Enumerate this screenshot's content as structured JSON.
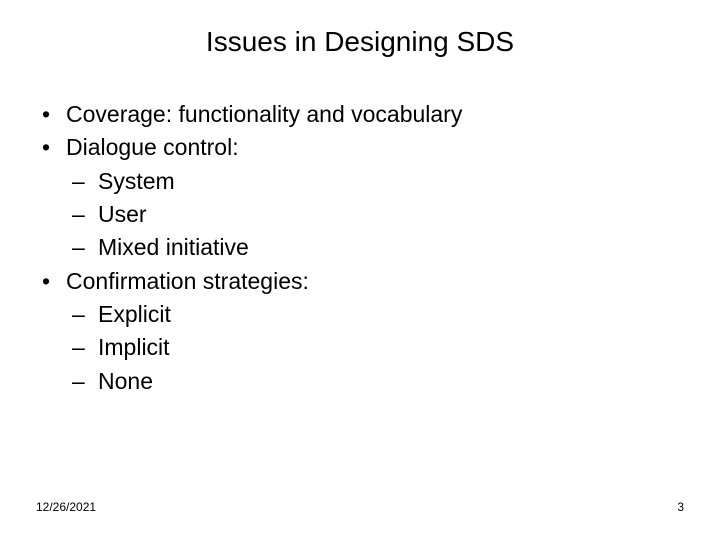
{
  "slide": {
    "title": "Issues in Designing SDS",
    "bullets": [
      {
        "text": "Coverage:  functionality and vocabulary",
        "subs": []
      },
      {
        "text": "Dialogue control:",
        "subs": [
          "System",
          "User",
          "Mixed initiative"
        ]
      },
      {
        "text": "Confirmation strategies:",
        "subs": [
          "Explicit",
          "Implicit",
          "None"
        ]
      }
    ],
    "bullet_char": "•",
    "dash_char": "–"
  },
  "footer": {
    "date": "12/26/2021",
    "page": "3"
  }
}
